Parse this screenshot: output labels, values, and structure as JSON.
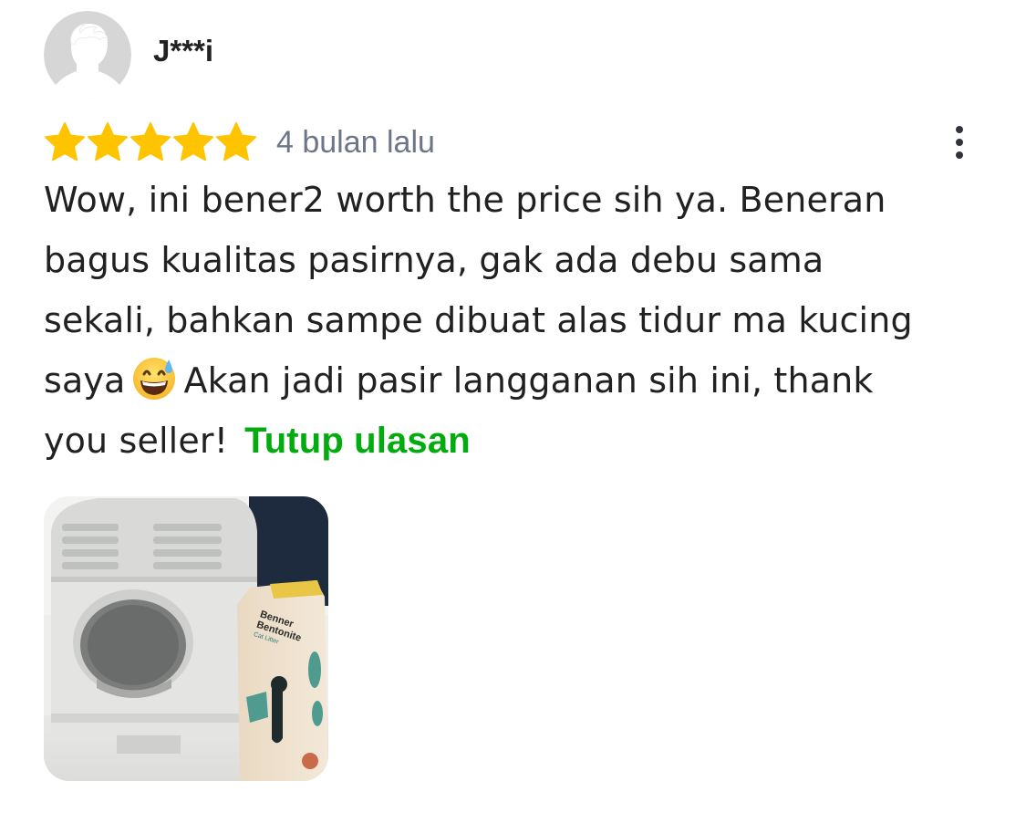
{
  "reviewer": {
    "name": "J***i",
    "avatar_icon": "default-user-avatar-icon"
  },
  "rating": {
    "stars": 5,
    "max_stars": 5,
    "star_color": "#ffc400",
    "time_ago": "4 bulan lalu"
  },
  "menu": {
    "icon": "more-vertical-icon"
  },
  "review": {
    "line1": "Wow, ini bener2 worth the price sih ya. Beneran",
    "line2": "bagus kualitas pasirnya, gak ada debu sama",
    "line3": "sekali, bahkan sampe dibuat alas tidur ma kucing",
    "line4_before": "saya",
    "emoji": "grinning-face-with-sweat-emoji",
    "line4_after": "Akan jadi pasir langganan sih ini, thank",
    "line5": "you seller!",
    "toggle_label": "Tutup ulasan",
    "toggle_color": "#03ac0e"
  },
  "media": {
    "product_text": "Benner Bentonite Cat Litter",
    "photo_description_icon": "review-photo-thumbnail"
  }
}
